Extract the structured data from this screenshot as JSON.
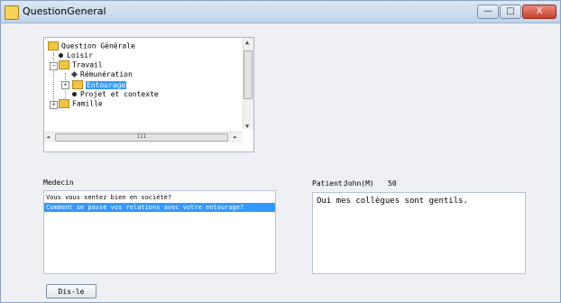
{
  "window": {
    "title": "QuestionGeneral",
    "minimize_label": "—",
    "maximize_label": "□",
    "close_label": "X"
  },
  "tree": {
    "root": "Question Générale",
    "items": [
      {
        "label": "Loisir"
      },
      {
        "label": "Travail"
      },
      {
        "label": "Rémunération"
      },
      {
        "label": "Entourage"
      },
      {
        "label": "Projet et contexte"
      },
      {
        "label": "Famille"
      }
    ],
    "selected": "Entourage"
  },
  "scroll": {
    "grip_label": "III",
    "left_arrow": "◄",
    "right_arrow": "►",
    "up_arrow": "▲",
    "down_arrow": "▼"
  },
  "medecin": {
    "label": "Medecin",
    "questions": [
      "Vous vous sentez bien en société?",
      "Comment se passe vos relations avec votre entourage?"
    ],
    "selected_index": 1
  },
  "patient": {
    "label": "Patient:",
    "name": "John(M)",
    "age": "50",
    "answer": "Oui mes collègues sont gentils."
  },
  "actions": {
    "say_label": "Dis-le"
  }
}
